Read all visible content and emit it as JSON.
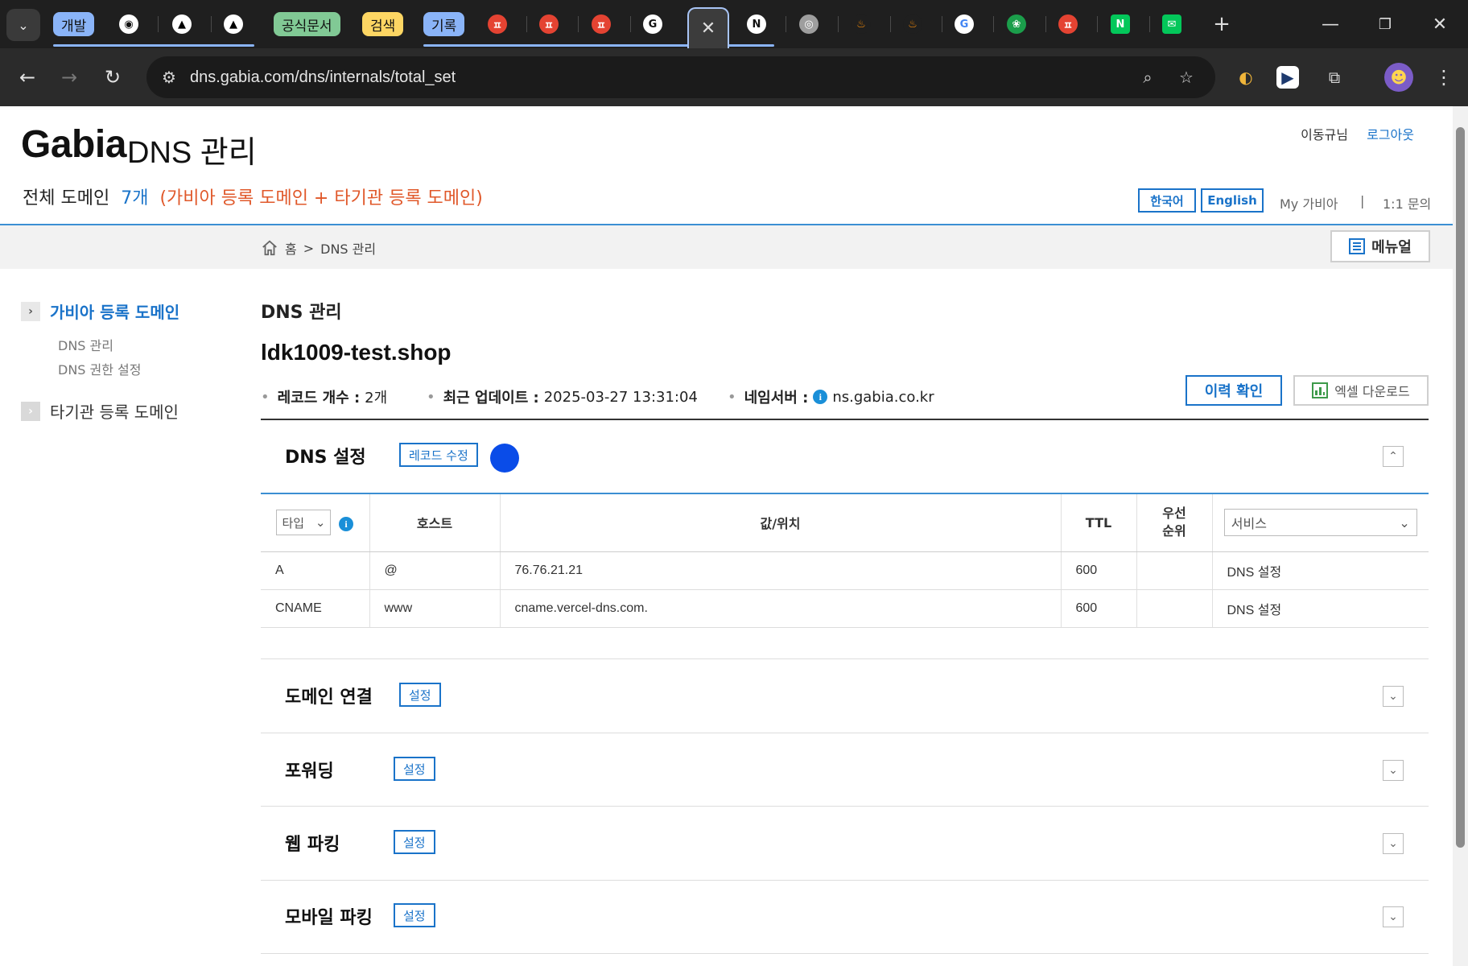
{
  "browser": {
    "tab_groups": [
      {
        "label": "개발",
        "color": "#8ab4f8"
      },
      {
        "label": "공식문서",
        "color": "#81c995"
      },
      {
        "label": "검색",
        "color": "#fdd663"
      },
      {
        "label": "기록",
        "color": "#8ab4f8"
      }
    ],
    "favicons": [
      {
        "name": "github-icon",
        "glyph": "◉",
        "bg": "#ffffff",
        "fg": "#111111"
      },
      {
        "name": "vercel-icon",
        "glyph": "▲",
        "bg": "#ffffff",
        "fg": "#000000"
      },
      {
        "name": "vercel-icon",
        "glyph": "▲",
        "bg": "#ffffff",
        "fg": "#000000"
      },
      {
        "name": "todoist-icon",
        "glyph": "ㅍ",
        "bg": "#e44332",
        "fg": "#ffffff"
      },
      {
        "name": "todoist-icon",
        "glyph": "ㅍ",
        "bg": "#e44332",
        "fg": "#ffffff"
      },
      {
        "name": "todoist-icon",
        "glyph": "ㅍ",
        "bg": "#e44332",
        "fg": "#ffffff"
      },
      {
        "name": "gabia-g-icon",
        "glyph": "G",
        "bg": "#ffffff",
        "fg": "#111111"
      },
      {
        "name": "notion-icon",
        "glyph": "N",
        "bg": "#ffffff",
        "fg": "#111111"
      },
      {
        "name": "chrome-icon",
        "glyph": "◎",
        "bg": "#9e9e9e",
        "fg": "#ffffff"
      },
      {
        "name": "firebase-icon",
        "glyph": "♨",
        "bg": "#1f1f1f",
        "fg": "#f58a07"
      },
      {
        "name": "firebase-icon",
        "glyph": "♨",
        "bg": "#1f1f1f",
        "fg": "#f58a07"
      },
      {
        "name": "google-icon",
        "glyph": "G",
        "bg": "#ffffff",
        "fg": "#4285f4"
      },
      {
        "name": "spring-icon",
        "glyph": "❀",
        "bg": "#1b9e4b",
        "fg": "#ffffff"
      },
      {
        "name": "todoist-icon",
        "glyph": "ㅍ",
        "bg": "#e44332",
        "fg": "#ffffff"
      },
      {
        "name": "naver-icon",
        "glyph": "N",
        "bg": "#03c75a",
        "fg": "#ffffff"
      },
      {
        "name": "line-works-icon",
        "glyph": "✉",
        "bg": "#03c75a",
        "fg": "#ffffff"
      }
    ],
    "url": "dns.gabia.com/dns/internals/total_set"
  },
  "header": {
    "logo": "Gabia",
    "logo_sub": "DNS 관리",
    "domain_label": "전체 도메인",
    "domain_count": "7개",
    "domain_note": "(가비아 등록 도메인 + 타기관 등록 도메인)",
    "user": "이동규님",
    "logout": "로그아웃",
    "lang_ko": "한국어",
    "lang_en": "English",
    "my_gabia": "My 가비아",
    "divider": "|",
    "inquiry": "1:1 문의"
  },
  "breadcrumb": {
    "home": "홈",
    "sep": ">",
    "current": "DNS 관리",
    "manual": "메뉴얼"
  },
  "sidebar": {
    "items": [
      {
        "label": "가비아 등록 도메인",
        "subs": [
          "DNS 관리",
          "DNS 권한 설정"
        ]
      },
      {
        "label": "타기관 등록 도메인"
      }
    ]
  },
  "main": {
    "title": "DNS 관리",
    "domain": "ldk1009-test.shop",
    "record_count_label": "레코드 개수 :",
    "record_count": "2개",
    "updated_label": "최근 업데이트 :",
    "updated": "2025-03-27 13:31:04",
    "ns_label": "네임서버 :",
    "ns": "ns.gabia.co.kr",
    "history_btn": "이력 확인",
    "excel_btn": "엑셀 다운로드",
    "dns_section": {
      "title": "DNS 설정",
      "edit_btn": "레코드 수정",
      "columns": {
        "type": "타입",
        "host": "호스트",
        "value": "값/위치",
        "ttl": "TTL",
        "priority": "우선\n순위",
        "service": "서비스"
      },
      "rows": [
        {
          "type": "A",
          "host": "@",
          "value": "76.76.21.21",
          "ttl": "600",
          "priority": "",
          "service": "DNS 설정"
        },
        {
          "type": "CNAME",
          "host": "www",
          "value": "cname.vercel-dns.com.",
          "ttl": "600",
          "priority": "",
          "service": "DNS 설정"
        }
      ]
    },
    "sections": [
      {
        "title": "도메인 연결",
        "btn": "설정"
      },
      {
        "title": "포워딩",
        "btn": "설정"
      },
      {
        "title": "웹 파킹",
        "btn": "설정"
      },
      {
        "title": "모바일 파킹",
        "btn": "설정"
      }
    ]
  }
}
